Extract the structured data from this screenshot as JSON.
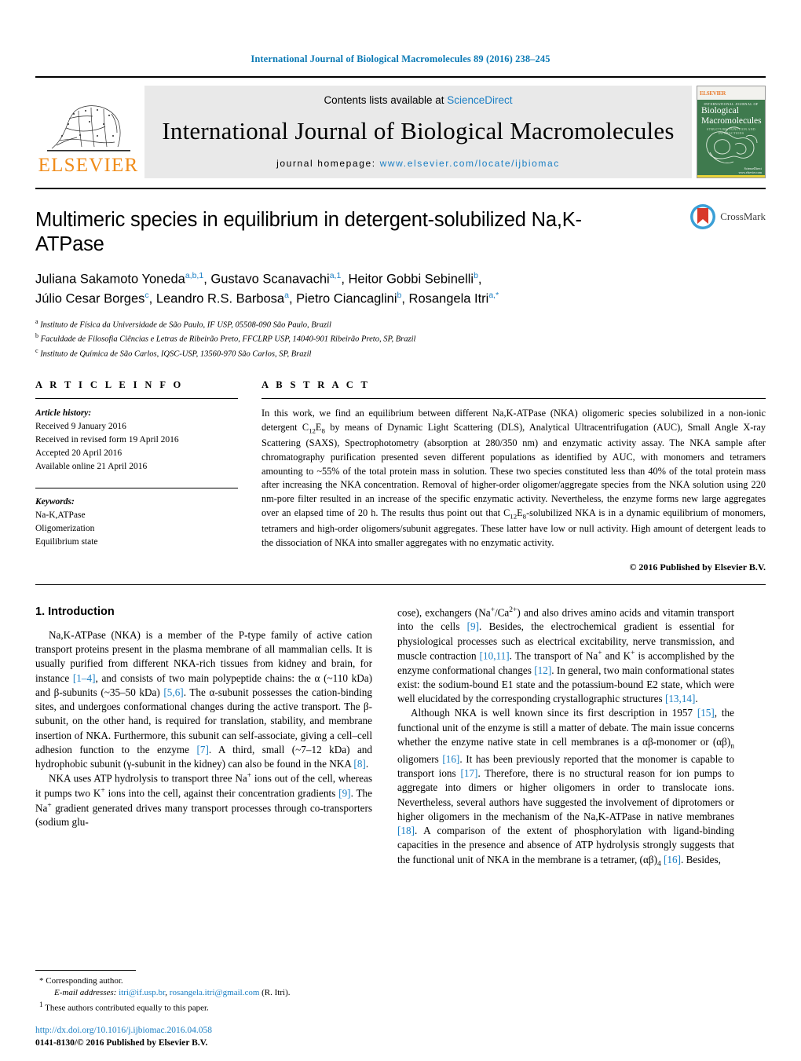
{
  "running_head": "International Journal of Biological Macromolecules 89 (2016) 238–245",
  "masthead": {
    "publisher_name": "ELSEVIER",
    "contents_prefix": "Contents lists available at ",
    "contents_link": "ScienceDirect",
    "journal_title": "International Journal of Biological Macromolecules",
    "homepage_prefix": "journal homepage: ",
    "homepage_url": "www.elsevier.com/locate/ijbiomac",
    "cover": {
      "publisher_mark": "ELSEVIER",
      "top_tiny": "INTERNATIONAL JOURNAL OF",
      "line1": "Biological",
      "line2": "Macromolecules",
      "subtitle": "STRUCTURE, FUNCTION AND INTERACTIONS",
      "sd_label": "ScienceDirect",
      "sd_url": "www.elsevier.com"
    }
  },
  "article": {
    "crossmark_label": "CrossMark",
    "title": "Multimeric species in equilibrium in detergent-solubilized Na,K-ATPase",
    "authors_line1_a": "Juliana Sakamoto Yoneda",
    "authors_line1_a_sup": "a,b,1",
    "authors_line1_b": ", Gustavo Scanavachi",
    "authors_line1_b_sup": "a,1",
    "authors_line1_c": ", Heitor Gobbi Sebinelli",
    "authors_line1_c_sup": "b",
    "authors_line1_end": ",",
    "authors_line2_a": "Júlio Cesar Borges",
    "authors_line2_a_sup": "c",
    "authors_line2_b": ", Leandro R.S. Barbosa",
    "authors_line2_b_sup": "a",
    "authors_line2_c": ", Pietro Ciancaglini",
    "authors_line2_c_sup": "b",
    "authors_line2_d": ", Rosangela Itri",
    "authors_line2_d_sup": "a,*",
    "affiliations": [
      {
        "marker": "a",
        "text": "Instituto de Física da Universidade de São Paulo, IF USP, 05508-090 São Paulo, Brazil"
      },
      {
        "marker": "b",
        "text": "Faculdade de Filosofia Ciências e Letras de Ribeirão Preto, FFCLRP USP, 14040-901 Ribeirão Preto, SP, Brazil"
      },
      {
        "marker": "c",
        "text": "Instituto de Química de São Carlos, IQSC-USP, 13560-970 São Carlos, SP, Brazil"
      }
    ]
  },
  "article_info": {
    "heading": "A R T I C L E    I N F O",
    "history_label": "Article history:",
    "history": [
      "Received 9 January 2016",
      "Received in revised form 19 April 2016",
      "Accepted 20 April 2016",
      "Available online 21 April 2016"
    ],
    "keywords_label": "Keywords:",
    "keywords": [
      "Na-K,ATPase",
      "Oligomerization",
      "Equilibrium state"
    ]
  },
  "abstract": {
    "heading": "A B S T R A C T",
    "paragraph_1": "In this work, we find an equilibrium between different Na,K-ATPase (NKA) oligomeric species solubilized in a non-ionic detergent C",
    "sub_12": "12",
    "paragraph_2": "E",
    "sub_8": "8",
    "paragraph_3": " by means of Dynamic Light Scattering (DLS), Analytical Ultracentrifugation (AUC), Small Angle X-ray Scattering (SAXS), Spectrophotometry (absorption at 280/350 nm) and enzymatic activity assay. The NKA sample after chromatography purification presented seven different populations as identified by AUC, with monomers and tetramers amounting to ~55% of the total protein mass in solution. These two species constituted less than 40% of the total protein mass after increasing the NKA concentration. Removal of higher-order oligomer/aggregate species from the NKA solution using 220 nm-pore filter resulted in an increase of the specific enzymatic activity. Nevertheless, the enzyme forms new large aggregates over an elapsed time of 20 h. The results thus point out that C",
    "paragraph_4": "E",
    "paragraph_5": "-solubilized NKA is in a dynamic equilibrium of monomers, tetramers and high-order oligomers/subunit aggregates. These latter have low or null activity. High amount of detergent leads to the dissociation of NKA into smaller aggregates with no enzymatic activity.",
    "copyright": "© 2016 Published by Elsevier B.V."
  },
  "body": {
    "section_heading": "1.  Introduction",
    "left_p1_a": "Na,K-ATPase (NKA) is a member of the P-type family of active cation transport proteins present in the plasma membrane of all mammalian cells. It is usually purified from different NKA-rich tissues from kidney and brain, for instance ",
    "left_p1_r1": "[1–4]",
    "left_p1_b": ", and consists of two main polypeptide chains: the α (~110 kDa) and β-subunits (~35–50 kDa) ",
    "left_p1_r2": "[5,6]",
    "left_p1_c": ". The α-subunit possesses the cation-binding sites, and undergoes conformational changes during the active transport. The β-subunit, on the other hand, is required for translation, stability, and membrane insertion of NKA. Furthermore, this subunit can self-associate, giving a cell–cell adhesion function to the enzyme ",
    "left_p1_r3": "[7]",
    "left_p1_d": ". A third, small (~7–12 kDa) and hydrophobic subunit (γ-subunit in the kidney) can also be found in the NKA ",
    "left_p1_r4": "[8]",
    "left_p1_e": ".",
    "left_p2_a": "NKA uses ATP hydrolysis to transport three Na",
    "left_p2_sup1": "+",
    "left_p2_b": " ions out of the cell, whereas it pumps two K",
    "left_p2_sup2": "+",
    "left_p2_c": " ions into the cell, against their concentration gradients ",
    "left_p2_r1": "[9]",
    "left_p2_d": ". The Na",
    "left_p2_sup3": "+",
    "left_p2_e": " gradient generated drives many transport processes through co-transporters (sodium glu-",
    "right_p1_a": "cose), exchangers (Na",
    "right_p1_sup1": "+",
    "right_p1_b": "/Ca",
    "right_p1_sup2": "2+",
    "right_p1_c": ") and also drives amino acids and vitamin transport into the cells ",
    "right_p1_r1": "[9]",
    "right_p1_d": ". Besides, the electrochemical gradient is essential for physiological processes such as electrical excitability, nerve transmission, and muscle contraction ",
    "right_p1_r2": "[10,11]",
    "right_p1_e": ". The transport of Na",
    "right_p1_sup3": "+",
    "right_p1_f": " and K",
    "right_p1_sup4": "+",
    "right_p1_g": " is accomplished by the enzyme conformational changes ",
    "right_p1_r3": "[12]",
    "right_p1_h": ". In general, two main conformational states exist: the sodium-bound E1 state and the potassium-bound E2 state, which were well elucidated by the corresponding crystallographic structures ",
    "right_p1_r4": "[13,14]",
    "right_p1_i": ".",
    "right_p2_a": "Although NKA is well known since its first description in 1957 ",
    "right_p2_r1": "[15]",
    "right_p2_b": ", the functional unit of the enzyme is still a matter of debate. The main issue concerns whether the enzyme native state in cell membranes is a αβ-monomer or (αβ)",
    "right_p2_subn": "n",
    "right_p2_c": " oligomers ",
    "right_p2_r2": "[16]",
    "right_p2_d": ". It has been previously reported that the monomer is capable to transport ions ",
    "right_p2_r3": "[17]",
    "right_p2_e": ". Therefore, there is no structural reason for ion pumps to aggregate into dimers or higher oligomers in order to translocate ions. Nevertheless, several authors have suggested the involvement of diprotomers or higher oligomers in the mechanism of the Na,K-ATPase in native membranes ",
    "right_p2_r4": "[18]",
    "right_p2_f": ". A comparison of the extent of phosphorylation with ligand-binding capacities in the presence and absence of ATP hydrolysis strongly suggests that the functional unit of NKA in the membrane is a tetramer, (αβ)",
    "right_p2_sub4": "4",
    "right_p2_g": " ",
    "right_p2_r5": "[16]",
    "right_p2_h": ". Besides,"
  },
  "footnotes": {
    "corresponding_marker": "*",
    "corresponding_text": "Corresponding author.",
    "email_label": "E-mail addresses:",
    "email_1": "itri@if.usp.br",
    "email_sep": ", ",
    "email_2": "rosangela.itri@gmail.com",
    "email_suffix": " (R. Itri).",
    "equal_marker": "1",
    "equal_text": "These authors contributed equally to this paper.",
    "doi": "http://dx.doi.org/10.1016/j.ijbiomac.2016.04.058",
    "issn_line": "0141-8130/© 2016 Published by Elsevier B.V."
  },
  "colors": {
    "link_blue": "#1b7fc4",
    "header_blue": "#0b7ab5",
    "elsevier_orange": "#F08C1A",
    "cover_green": "#3f7a4e",
    "band_grey": "#e9e9e9"
  }
}
